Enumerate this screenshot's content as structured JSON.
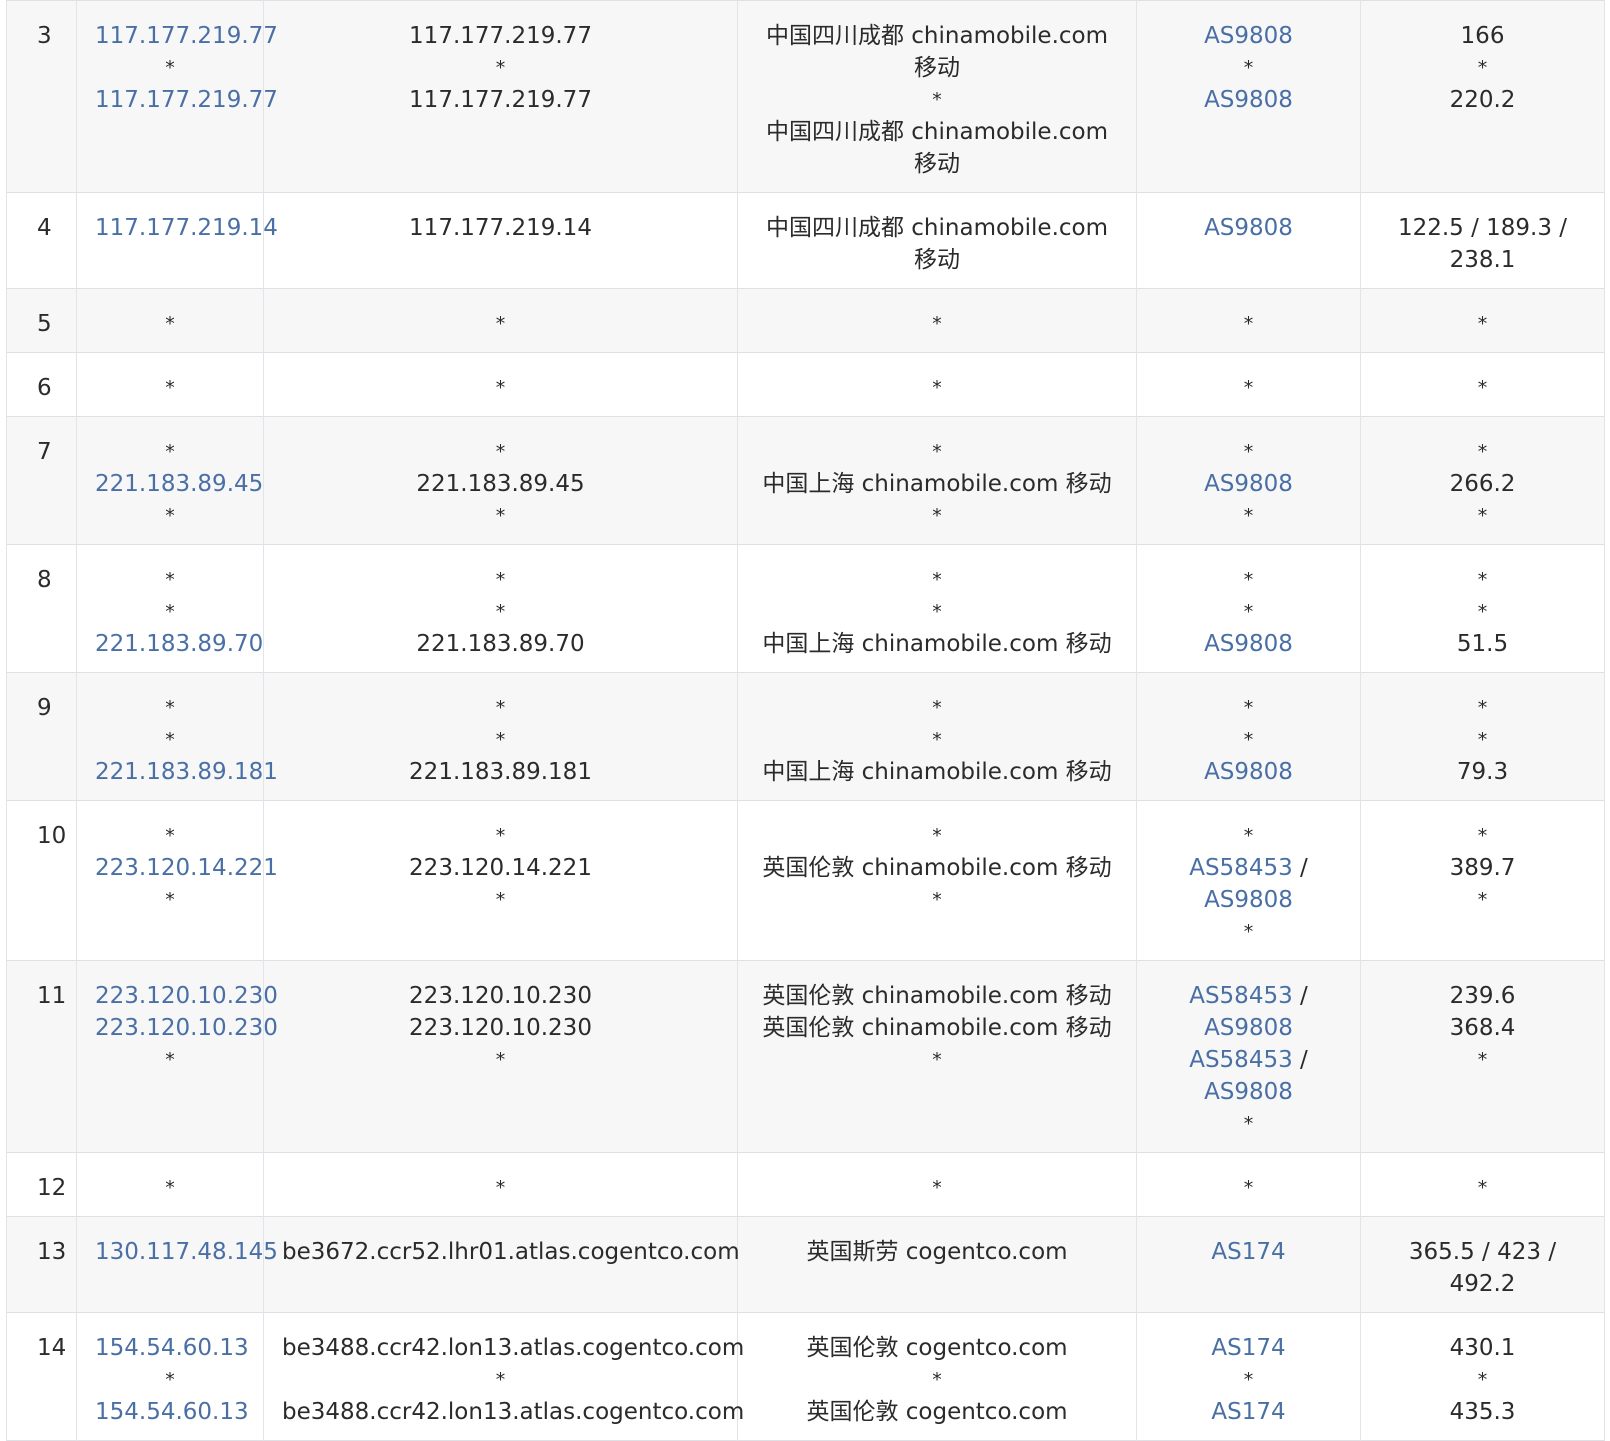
{
  "rows": [
    {
      "hop": "3",
      "ip": [
        "117.177.219.77",
        "*",
        "117.177.219.77"
      ],
      "host": [
        "117.177.219.77",
        "*",
        "117.177.219.77"
      ],
      "loc": [
        "中国四川成都 chinamobile.com 移动",
        "*",
        "中国四川成都 chinamobile.com 移动"
      ],
      "as": [
        "AS9808",
        "*",
        "AS9808"
      ],
      "rtt": [
        "166",
        "*",
        "220.2"
      ]
    },
    {
      "hop": "4",
      "ip": [
        "117.177.219.14"
      ],
      "host": [
        "117.177.219.14"
      ],
      "loc": [
        "中国四川成都 chinamobile.com 移动"
      ],
      "as": [
        "AS9808"
      ],
      "rtt": [
        "122.5 / 189.3 / 238.1"
      ]
    },
    {
      "hop": "5",
      "ip": [
        "*"
      ],
      "host": [
        "*"
      ],
      "loc": [
        "*"
      ],
      "as": [
        "*"
      ],
      "rtt": [
        "*"
      ]
    },
    {
      "hop": "6",
      "ip": [
        "*"
      ],
      "host": [
        "*"
      ],
      "loc": [
        "*"
      ],
      "as": [
        "*"
      ],
      "rtt": [
        "*"
      ]
    },
    {
      "hop": "7",
      "ip": [
        "*",
        "221.183.89.45",
        "*"
      ],
      "host": [
        "*",
        "221.183.89.45",
        "*"
      ],
      "loc": [
        "*",
        "中国上海 chinamobile.com 移动",
        "*"
      ],
      "as": [
        "*",
        "AS9808",
        "*"
      ],
      "rtt": [
        "*",
        "266.2",
        "*"
      ]
    },
    {
      "hop": "8",
      "ip": [
        "*",
        "*",
        "221.183.89.70"
      ],
      "host": [
        "*",
        "*",
        "221.183.89.70"
      ],
      "loc": [
        "*",
        "*",
        "中国上海 chinamobile.com 移动"
      ],
      "as": [
        "*",
        "*",
        "AS9808"
      ],
      "rtt": [
        "*",
        "*",
        "51.5"
      ]
    },
    {
      "hop": "9",
      "ip": [
        "*",
        "*",
        "221.183.89.181"
      ],
      "host": [
        "*",
        "*",
        "221.183.89.181"
      ],
      "loc": [
        "*",
        "*",
        "中国上海 chinamobile.com 移动"
      ],
      "as": [
        "*",
        "*",
        "AS9808"
      ],
      "rtt": [
        "*",
        "*",
        "79.3"
      ]
    },
    {
      "hop": "10",
      "ip": [
        "*",
        "223.120.14.221",
        "*"
      ],
      "host": [
        "*",
        "223.120.14.221",
        "*"
      ],
      "loc": [
        "*",
        "英国伦敦 chinamobile.com 移动",
        "*"
      ],
      "as": [
        "*",
        "AS58453 / AS9808",
        "*"
      ],
      "rtt": [
        "*",
        "389.7",
        "*"
      ]
    },
    {
      "hop": "11",
      "ip": [
        "223.120.10.230",
        "223.120.10.230",
        "*"
      ],
      "host": [
        "223.120.10.230",
        "223.120.10.230",
        "*"
      ],
      "loc": [
        "英国伦敦 chinamobile.com 移动",
        "英国伦敦 chinamobile.com 移动",
        "*"
      ],
      "as": [
        "AS58453 / AS9808",
        "AS58453 / AS9808",
        "*"
      ],
      "rtt": [
        "239.6",
        "368.4",
        "*"
      ]
    },
    {
      "hop": "12",
      "ip": [
        "*"
      ],
      "host": [
        "*"
      ],
      "loc": [
        "*"
      ],
      "as": [
        "*"
      ],
      "rtt": [
        "*"
      ]
    },
    {
      "hop": "13",
      "ip": [
        "130.117.48.145"
      ],
      "host": [
        "be3672.ccr52.lhr01.atlas.cogentco.com"
      ],
      "loc": [
        "英国斯劳 cogentco.com"
      ],
      "as": [
        "AS174"
      ],
      "rtt": [
        "365.5 / 423 / 492.2"
      ]
    },
    {
      "hop": "14",
      "ip": [
        "154.54.60.13",
        "*",
        "154.54.60.13"
      ],
      "host": [
        "be3488.ccr42.lon13.atlas.cogentco.com",
        "*",
        "be3488.ccr42.lon13.atlas.cogentco.com"
      ],
      "loc": [
        "英国伦敦 cogentco.com",
        "*",
        "英国伦敦 cogentco.com"
      ],
      "as": [
        "AS174",
        "*",
        "AS174"
      ],
      "rtt": [
        "430.1",
        "*",
        "435.3"
      ]
    }
  ]
}
